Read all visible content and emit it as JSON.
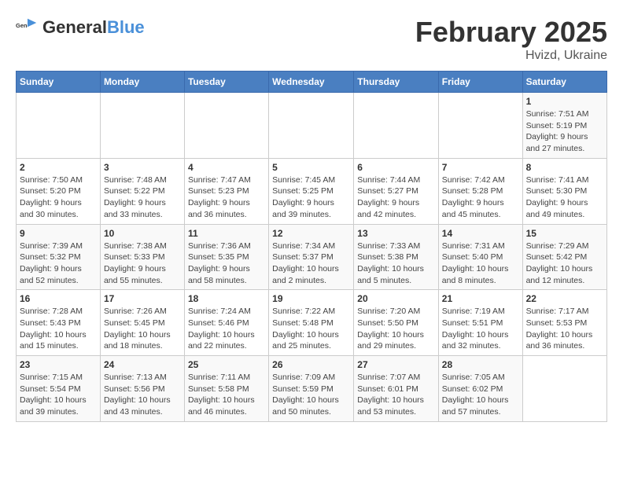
{
  "logo": {
    "text_general": "General",
    "text_blue": "Blue"
  },
  "calendar": {
    "title": "February 2025",
    "subtitle": "Hvizd, Ukraine"
  },
  "weekdays": [
    "Sunday",
    "Monday",
    "Tuesday",
    "Wednesday",
    "Thursday",
    "Friday",
    "Saturday"
  ],
  "weeks": [
    [
      {
        "day": "",
        "info": ""
      },
      {
        "day": "",
        "info": ""
      },
      {
        "day": "",
        "info": ""
      },
      {
        "day": "",
        "info": ""
      },
      {
        "day": "",
        "info": ""
      },
      {
        "day": "",
        "info": ""
      },
      {
        "day": "1",
        "info": "Sunrise: 7:51 AM\nSunset: 5:19 PM\nDaylight: 9 hours and 27 minutes."
      }
    ],
    [
      {
        "day": "2",
        "info": "Sunrise: 7:50 AM\nSunset: 5:20 PM\nDaylight: 9 hours and 30 minutes."
      },
      {
        "day": "3",
        "info": "Sunrise: 7:48 AM\nSunset: 5:22 PM\nDaylight: 9 hours and 33 minutes."
      },
      {
        "day": "4",
        "info": "Sunrise: 7:47 AM\nSunset: 5:23 PM\nDaylight: 9 hours and 36 minutes."
      },
      {
        "day": "5",
        "info": "Sunrise: 7:45 AM\nSunset: 5:25 PM\nDaylight: 9 hours and 39 minutes."
      },
      {
        "day": "6",
        "info": "Sunrise: 7:44 AM\nSunset: 5:27 PM\nDaylight: 9 hours and 42 minutes."
      },
      {
        "day": "7",
        "info": "Sunrise: 7:42 AM\nSunset: 5:28 PM\nDaylight: 9 hours and 45 minutes."
      },
      {
        "day": "8",
        "info": "Sunrise: 7:41 AM\nSunset: 5:30 PM\nDaylight: 9 hours and 49 minutes."
      }
    ],
    [
      {
        "day": "9",
        "info": "Sunrise: 7:39 AM\nSunset: 5:32 PM\nDaylight: 9 hours and 52 minutes."
      },
      {
        "day": "10",
        "info": "Sunrise: 7:38 AM\nSunset: 5:33 PM\nDaylight: 9 hours and 55 minutes."
      },
      {
        "day": "11",
        "info": "Sunrise: 7:36 AM\nSunset: 5:35 PM\nDaylight: 9 hours and 58 minutes."
      },
      {
        "day": "12",
        "info": "Sunrise: 7:34 AM\nSunset: 5:37 PM\nDaylight: 10 hours and 2 minutes."
      },
      {
        "day": "13",
        "info": "Sunrise: 7:33 AM\nSunset: 5:38 PM\nDaylight: 10 hours and 5 minutes."
      },
      {
        "day": "14",
        "info": "Sunrise: 7:31 AM\nSunset: 5:40 PM\nDaylight: 10 hours and 8 minutes."
      },
      {
        "day": "15",
        "info": "Sunrise: 7:29 AM\nSunset: 5:42 PM\nDaylight: 10 hours and 12 minutes."
      }
    ],
    [
      {
        "day": "16",
        "info": "Sunrise: 7:28 AM\nSunset: 5:43 PM\nDaylight: 10 hours and 15 minutes."
      },
      {
        "day": "17",
        "info": "Sunrise: 7:26 AM\nSunset: 5:45 PM\nDaylight: 10 hours and 18 minutes."
      },
      {
        "day": "18",
        "info": "Sunrise: 7:24 AM\nSunset: 5:46 PM\nDaylight: 10 hours and 22 minutes."
      },
      {
        "day": "19",
        "info": "Sunrise: 7:22 AM\nSunset: 5:48 PM\nDaylight: 10 hours and 25 minutes."
      },
      {
        "day": "20",
        "info": "Sunrise: 7:20 AM\nSunset: 5:50 PM\nDaylight: 10 hours and 29 minutes."
      },
      {
        "day": "21",
        "info": "Sunrise: 7:19 AM\nSunset: 5:51 PM\nDaylight: 10 hours and 32 minutes."
      },
      {
        "day": "22",
        "info": "Sunrise: 7:17 AM\nSunset: 5:53 PM\nDaylight: 10 hours and 36 minutes."
      }
    ],
    [
      {
        "day": "23",
        "info": "Sunrise: 7:15 AM\nSunset: 5:54 PM\nDaylight: 10 hours and 39 minutes."
      },
      {
        "day": "24",
        "info": "Sunrise: 7:13 AM\nSunset: 5:56 PM\nDaylight: 10 hours and 43 minutes."
      },
      {
        "day": "25",
        "info": "Sunrise: 7:11 AM\nSunset: 5:58 PM\nDaylight: 10 hours and 46 minutes."
      },
      {
        "day": "26",
        "info": "Sunrise: 7:09 AM\nSunset: 5:59 PM\nDaylight: 10 hours and 50 minutes."
      },
      {
        "day": "27",
        "info": "Sunrise: 7:07 AM\nSunset: 6:01 PM\nDaylight: 10 hours and 53 minutes."
      },
      {
        "day": "28",
        "info": "Sunrise: 7:05 AM\nSunset: 6:02 PM\nDaylight: 10 hours and 57 minutes."
      },
      {
        "day": "",
        "info": ""
      }
    ]
  ]
}
